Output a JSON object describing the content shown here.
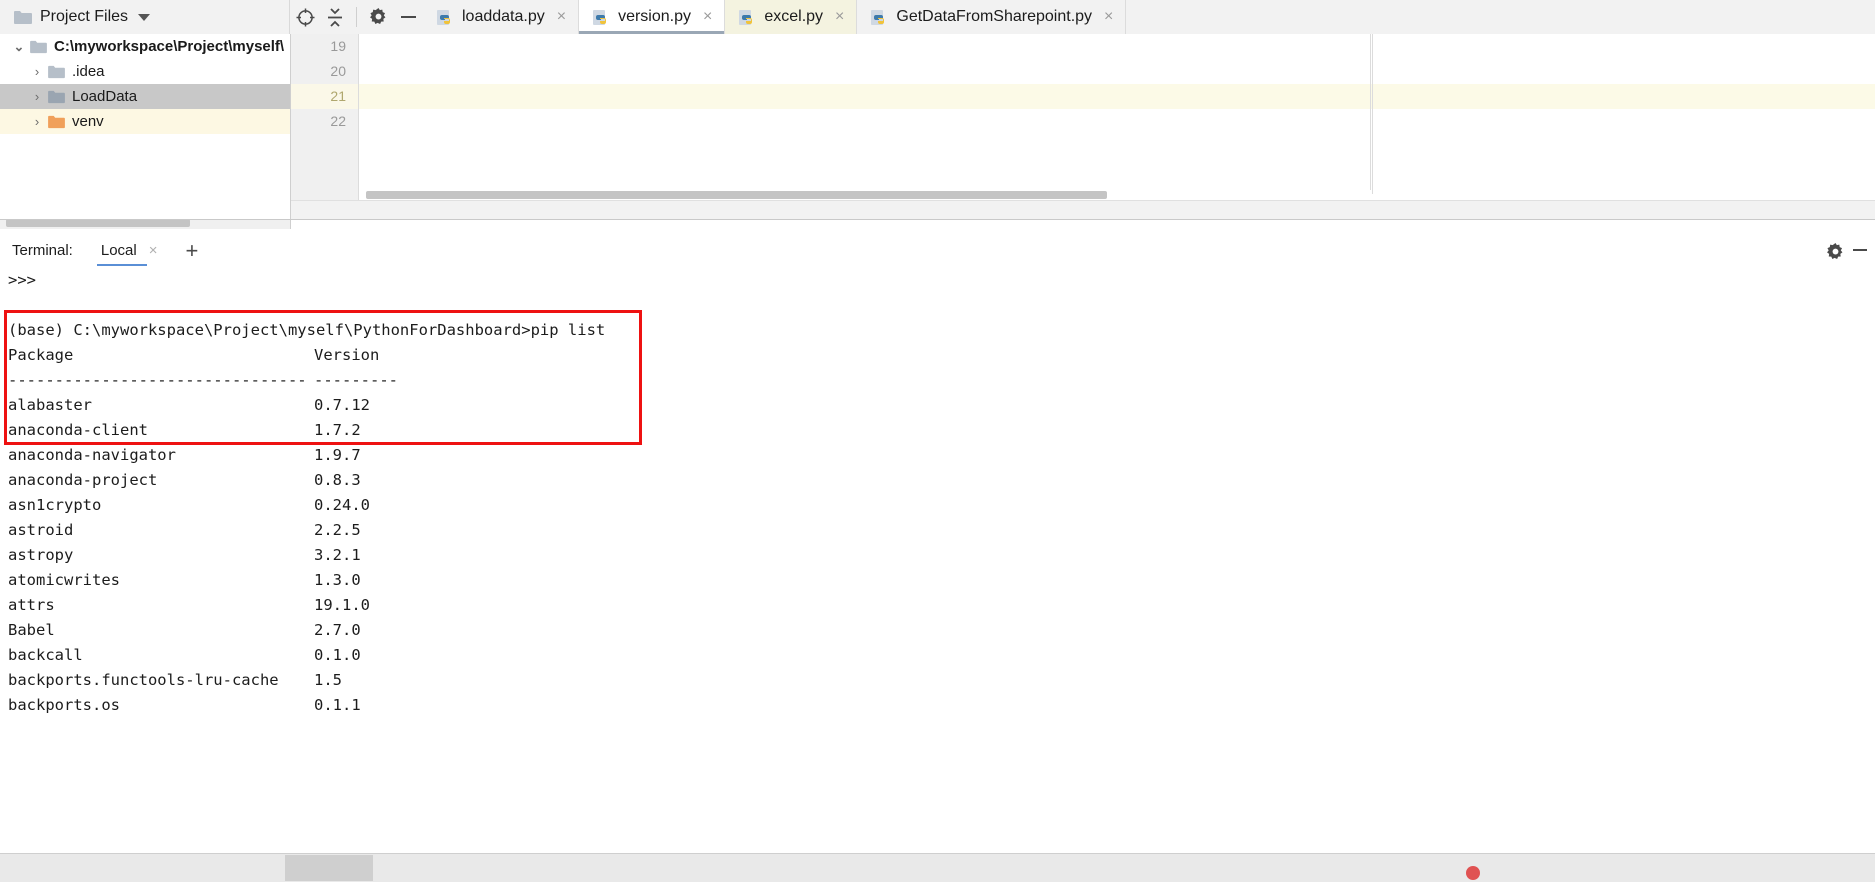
{
  "toolbar": {
    "project_title": "Project Files",
    "dropdown_icon": "chevron-down-icon",
    "locate_icon": "crosshair-target-icon",
    "collapse_icon": "collapse-all-icon",
    "settings_icon": "gear-icon",
    "hide_icon": "minimize-icon",
    "folder_icon": "folder-icon"
  },
  "tabs": [
    {
      "label": "loaddata.py",
      "state": "inactive",
      "close": "×",
      "icon": "python-file-icon"
    },
    {
      "label": "version.py",
      "state": "selected",
      "close": "×",
      "icon": "python-file-icon"
    },
    {
      "label": "excel.py",
      "state": "modified",
      "close": "×",
      "icon": "python-file-icon"
    },
    {
      "label": "GetDataFromSharepoint.py",
      "state": "inactive",
      "close": "×",
      "icon": "python-file-icon"
    }
  ],
  "project_tree": [
    {
      "label": "C:\\myworkspace\\Project\\myself\\",
      "depth": 0,
      "expanded": true,
      "arrow": "⌄",
      "state": "root",
      "folder": "plain"
    },
    {
      "label": ".idea",
      "depth": 1,
      "expanded": false,
      "arrow": "›",
      "state": "normal",
      "folder": "plain"
    },
    {
      "label": "LoadData",
      "depth": 1,
      "expanded": false,
      "arrow": "›",
      "state": "selected",
      "folder": "plain"
    },
    {
      "label": "venv",
      "depth": 1,
      "expanded": false,
      "arrow": "›",
      "state": "highlight",
      "folder": "orange"
    }
  ],
  "editor": {
    "line_numbers": [
      "19",
      "20",
      "21",
      "22"
    ],
    "current_line": "21",
    "content_lines": [
      "",
      "",
      "",
      ""
    ]
  },
  "terminal": {
    "label": "Terminal:",
    "tab_label": "Local",
    "tab_close": "×",
    "add_label": "+",
    "settings_icon": "gear-icon",
    "hide_icon": "minimize-icon",
    "prompt_line": ">>>",
    "command_line": "(base) C:\\myworkspace\\Project\\myself\\PythonForDashboard>pip list",
    "header_name": "Package",
    "header_version": "Version",
    "divider_name": "--------------------------------",
    "divider_version": "---------",
    "packages": [
      {
        "name": "alabaster",
        "version": "0.7.12"
      },
      {
        "name": "anaconda-client",
        "version": "1.7.2"
      },
      {
        "name": "anaconda-navigator",
        "version": "1.9.7"
      },
      {
        "name": "anaconda-project",
        "version": "0.8.3"
      },
      {
        "name": "asn1crypto",
        "version": "0.24.0"
      },
      {
        "name": "astroid",
        "version": "2.2.5"
      },
      {
        "name": "astropy",
        "version": "3.2.1"
      },
      {
        "name": "atomicwrites",
        "version": "1.3.0"
      },
      {
        "name": "attrs",
        "version": "19.1.0"
      },
      {
        "name": "Babel",
        "version": "2.7.0"
      },
      {
        "name": "backcall",
        "version": "0.1.0"
      },
      {
        "name": "backports.functools-lru-cache",
        "version": "1.5"
      },
      {
        "name": "backports.os",
        "version": "0.1.1"
      }
    ]
  },
  "annotation": {
    "name": "red-highlight-box",
    "color": "#ee1111"
  },
  "colors": {
    "accent": "#5a8fd6",
    "selection": "#c8c8c8",
    "highlight_row": "#fdf8e3",
    "modified_tab": "#f4f3e0",
    "annotation_red": "#ee1111"
  }
}
